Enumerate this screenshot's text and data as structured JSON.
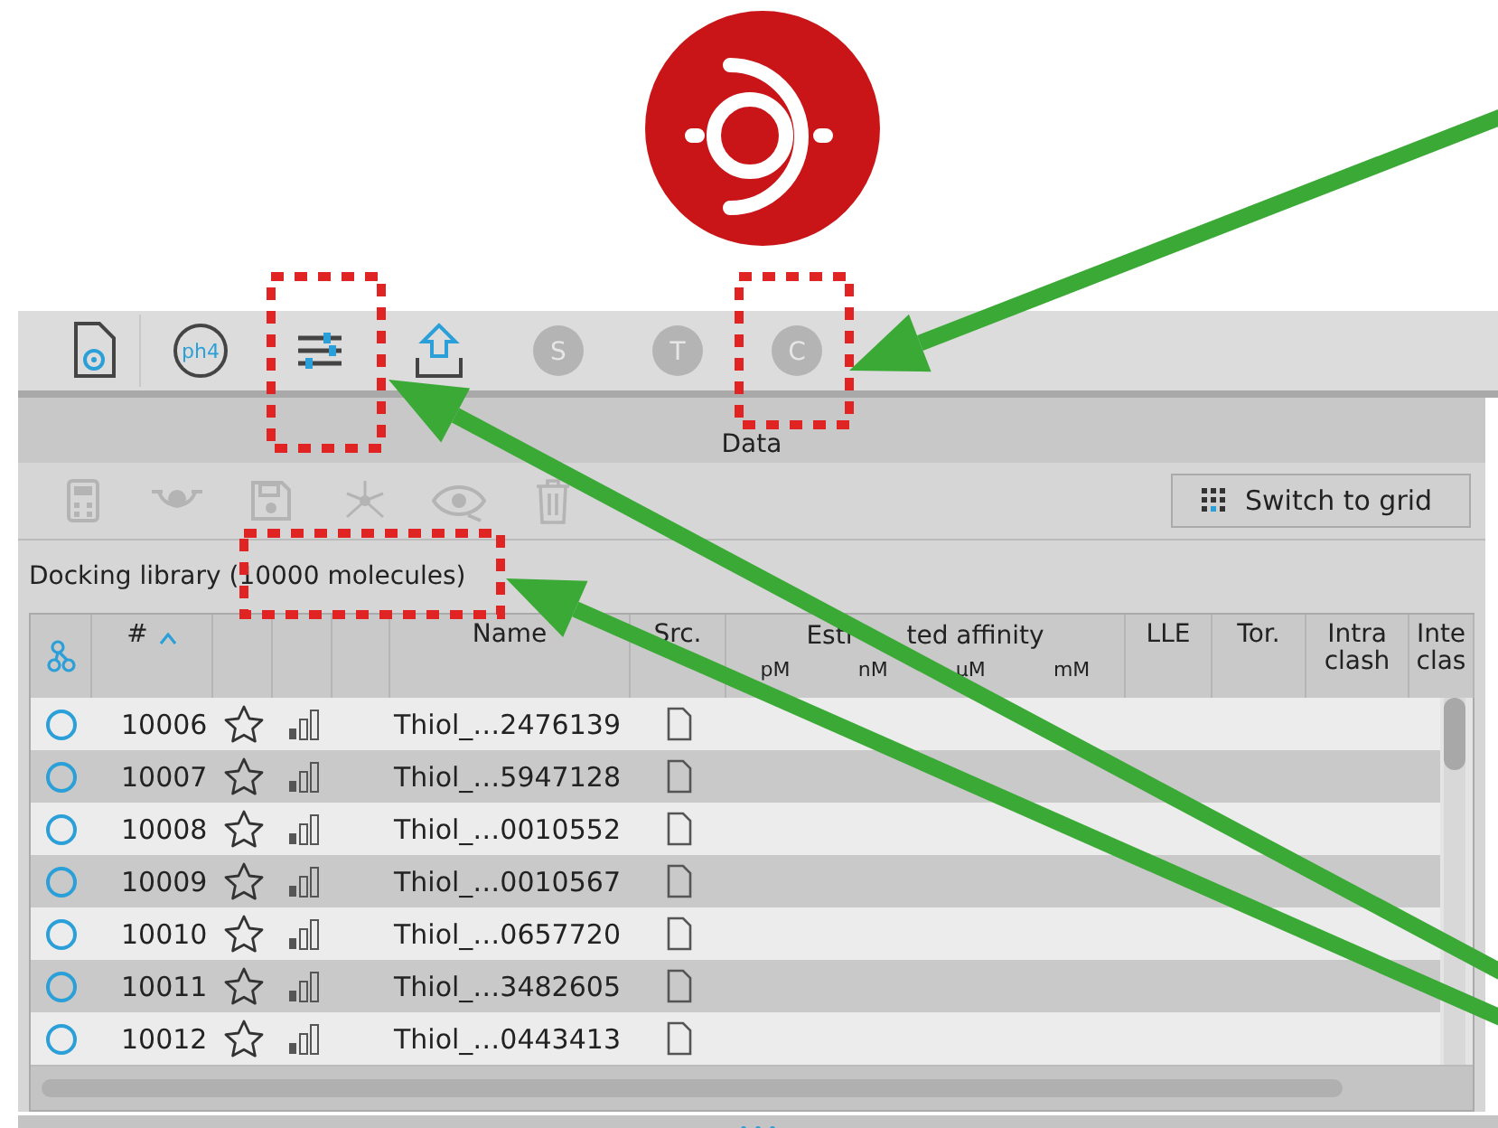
{
  "toolbar": [
    {
      "kind": "document",
      "disabled": false
    },
    {
      "kind": "ph4",
      "label": "ph4",
      "disabled": false
    },
    {
      "kind": "sliders",
      "disabled": false
    },
    {
      "kind": "upload",
      "disabled": false
    },
    {
      "kind": "letter",
      "label": "S",
      "disabled": true
    },
    {
      "kind": "letter",
      "label": "T",
      "disabled": true
    },
    {
      "kind": "letter",
      "label": "C",
      "disabled": true
    }
  ],
  "panel": {
    "title": "Data",
    "actions": [
      {
        "kind": "calculator",
        "disabled": true
      },
      {
        "kind": "eye",
        "disabled": true
      },
      {
        "kind": "save",
        "disabled": true
      },
      {
        "kind": "network",
        "disabled": true
      },
      {
        "kind": "eye-slash",
        "disabled": true
      },
      {
        "kind": "trash",
        "disabled": true
      }
    ],
    "switch_button": "Switch to grid",
    "library_label": "Docking library (10000 molecules)",
    "table": {
      "columns": [
        {
          "kind": "link"
        },
        {
          "kind": "text",
          "label": "#",
          "sorted": true
        },
        {
          "kind": "blank"
        },
        {
          "kind": "blank"
        },
        {
          "kind": "blank"
        },
        {
          "kind": "text",
          "label": "Name"
        },
        {
          "kind": "text",
          "label": "Src."
        },
        {
          "kind": "group",
          "label_fragments": [
            "Esti",
            "ted affinity"
          ],
          "units": [
            "pM",
            "nM",
            "µM",
            "mM"
          ]
        },
        {
          "kind": "text",
          "label": "LLE"
        },
        {
          "kind": "text",
          "label": "Tor."
        },
        {
          "kind": "text",
          "label": "Intra clash"
        },
        {
          "kind": "text",
          "label": "Inte clas"
        }
      ],
      "rows": [
        {
          "number": "10006",
          "name": "Thiol_…2476139"
        },
        {
          "number": "10007",
          "name": "Thiol_…5947128"
        },
        {
          "number": "10008",
          "name": "Thiol_…0010552"
        },
        {
          "number": "10009",
          "name": "Thiol_…0010567"
        },
        {
          "number": "10010",
          "name": "Thiol_…0657720"
        },
        {
          "number": "10011",
          "name": "Thiol_…3482605"
        },
        {
          "number": "10012",
          "name": "Thiol_…0443413"
        }
      ]
    }
  }
}
